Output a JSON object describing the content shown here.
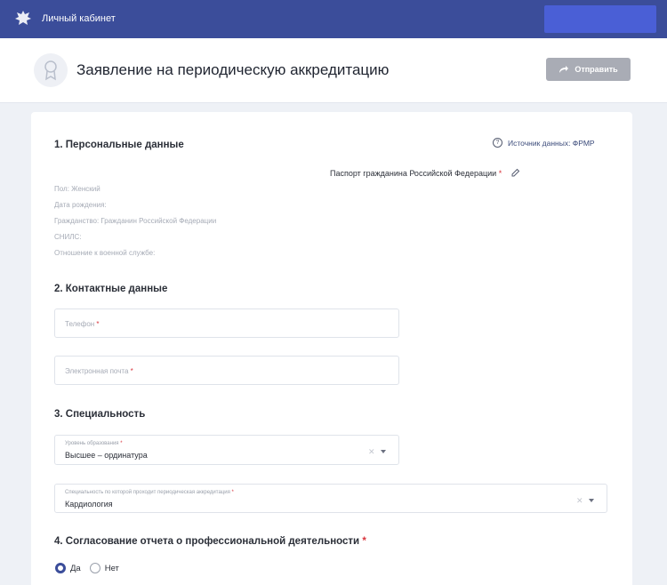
{
  "topbar": {
    "title": "Личный кабинет"
  },
  "header": {
    "title": "Заявление на периодическую аккредитацию",
    "send_label": "Отправить"
  },
  "personal": {
    "title": "1. Персональные данные",
    "source": "Источник данных: ФРМР",
    "passport": "Паспорт гражданина Российской Федерации",
    "lines": [
      "Пол: Женский",
      "Дата рождения:",
      "Гражданство: Гражданин Российской Федерации",
      "СНИЛС:",
      "Отношение к военной службе:"
    ]
  },
  "contacts": {
    "title": "2. Контактные данные",
    "phone_placeholder": "Телефон",
    "email_placeholder": "Электронная почта"
  },
  "specialty": {
    "title": "3. Специальность",
    "level_label": "Уровень образования",
    "level_value": "Высшее – ординатура",
    "spec_label": "Специальность по которой проходит периодическая аккредитация",
    "spec_value": "Кардиология"
  },
  "agreement": {
    "title": "4. Согласование отчета о профессиональной деятельности",
    "yes": "Да",
    "no": "Нет",
    "selected": "yes"
  },
  "colors": {
    "topbar": "#3b4d9a",
    "accent": "#4a5fd6",
    "required": "#d9363e"
  }
}
